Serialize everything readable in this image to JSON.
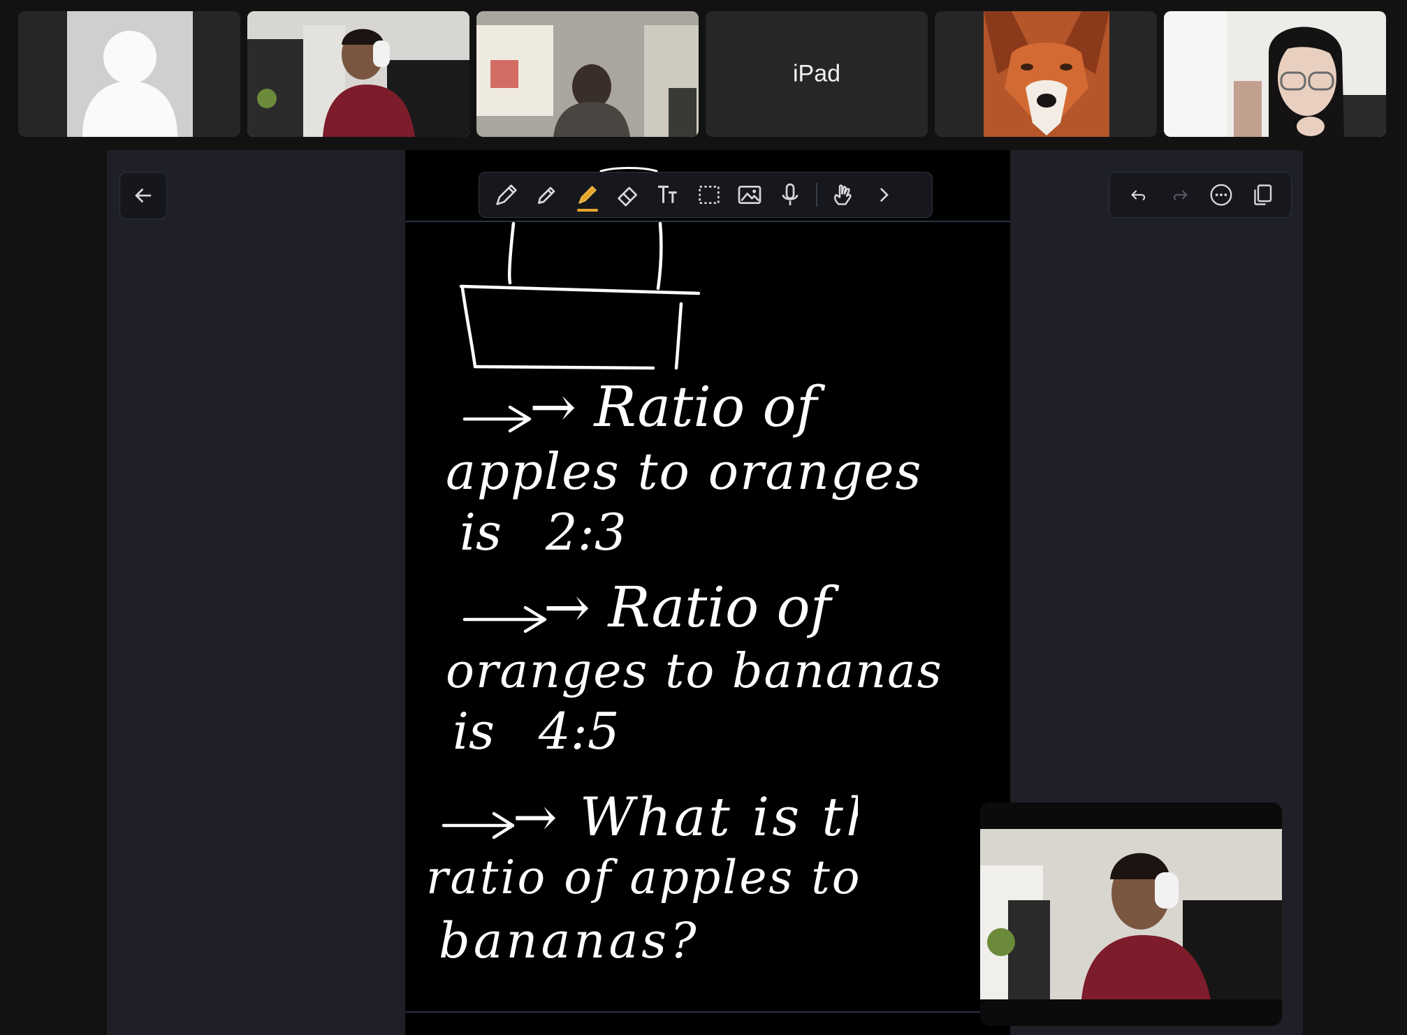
{
  "participants": [
    {
      "id": "p1",
      "type": "placeholder",
      "label": "participant-avatar"
    },
    {
      "id": "p2",
      "type": "video",
      "active": true
    },
    {
      "id": "p3",
      "type": "video"
    },
    {
      "id": "p4",
      "type": "name",
      "name": "iPad"
    },
    {
      "id": "p5",
      "type": "video"
    },
    {
      "id": "p6",
      "type": "video"
    }
  ],
  "toolbar": {
    "tools": [
      "pen-icon",
      "pencil-icon",
      "highlighter-icon",
      "eraser-icon",
      "text-icon",
      "lasso-select-icon",
      "image-icon",
      "microphone-icon",
      "hand-touch-icon",
      "chevron-right-icon"
    ],
    "active": "highlighter-icon",
    "accent": "#e5a52a"
  },
  "right_controls": [
    "undo-icon",
    "redo-icon",
    "more-icon",
    "pages-icon"
  ],
  "notes": {
    "line1": "→ Ratio of",
    "line2": "apples to oranges",
    "line3": "is 2:3",
    "line4": "→ Ratio of",
    "line5": "oranges to bananas",
    "line6": "is 4:5",
    "line7": "→ What is the",
    "line8": "ratio of apples to",
    "line9": "bananas?"
  },
  "colors": {
    "active_speaker": "#5dd36a",
    "canvas": "#000000",
    "share_bg": "#1e1f27",
    "app_bg": "#121212"
  }
}
